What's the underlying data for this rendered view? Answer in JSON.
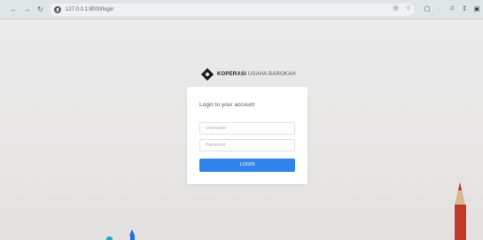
{
  "browser": {
    "url": "127.0.0.1:8000/login",
    "icons": [
      "back-icon",
      "forward-icon",
      "reload-icon",
      "site-info-icon",
      "lens-icon",
      "star-icon",
      "extension-icon",
      "menu-icon"
    ]
  },
  "brand": {
    "name_bold": "KOPERASI",
    "name_rest": "USAHA BAROKAH"
  },
  "login": {
    "title": "Login to your account",
    "username_placeholder": "Username",
    "password_placeholder": "Password",
    "button_label": "LOGIN"
  },
  "colors": {
    "button": "#2f84ec",
    "background": "#e9e8e8",
    "card": "#ffffff"
  }
}
